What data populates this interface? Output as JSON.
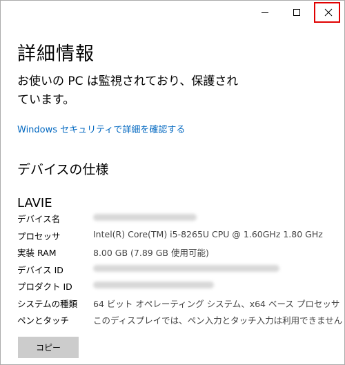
{
  "window": {
    "title": "詳細情報",
    "controls": {
      "minimize": "—",
      "maximize": "☐",
      "close": "✕"
    }
  },
  "status": {
    "message": "お使いの PC は監視されており、保護されています。"
  },
  "security_link": "Windows セキュリティで詳細を確認する",
  "device_specs": {
    "section_title": "デバイスの仕様",
    "device_name_heading": "LAVIE",
    "rows": [
      {
        "label": "デバイス名",
        "value": ""
      },
      {
        "label": "プロセッサ",
        "value": "Intel(R) Core(TM) i5-8265U CPU @ 1.60GHz   1.80 GHz"
      },
      {
        "label": "実装 RAM",
        "value": "8.00 GB (7.89 GB 使用可能)"
      },
      {
        "label": "デバイス ID",
        "value": ""
      },
      {
        "label": "プロダクト ID",
        "value": ""
      },
      {
        "label": "システムの種類",
        "value": "64 ビット オペレーティング システム、x64 ベース プロセッサ"
      },
      {
        "label": "ペンとタッチ",
        "value": "このディスプレイでは、ペン入力とタッチ入力は利用できません"
      }
    ]
  },
  "copy_button": "コピー",
  "colors": {
    "link": "#0067c0",
    "highlight": "#e00000",
    "button_bg": "#cccccc"
  }
}
